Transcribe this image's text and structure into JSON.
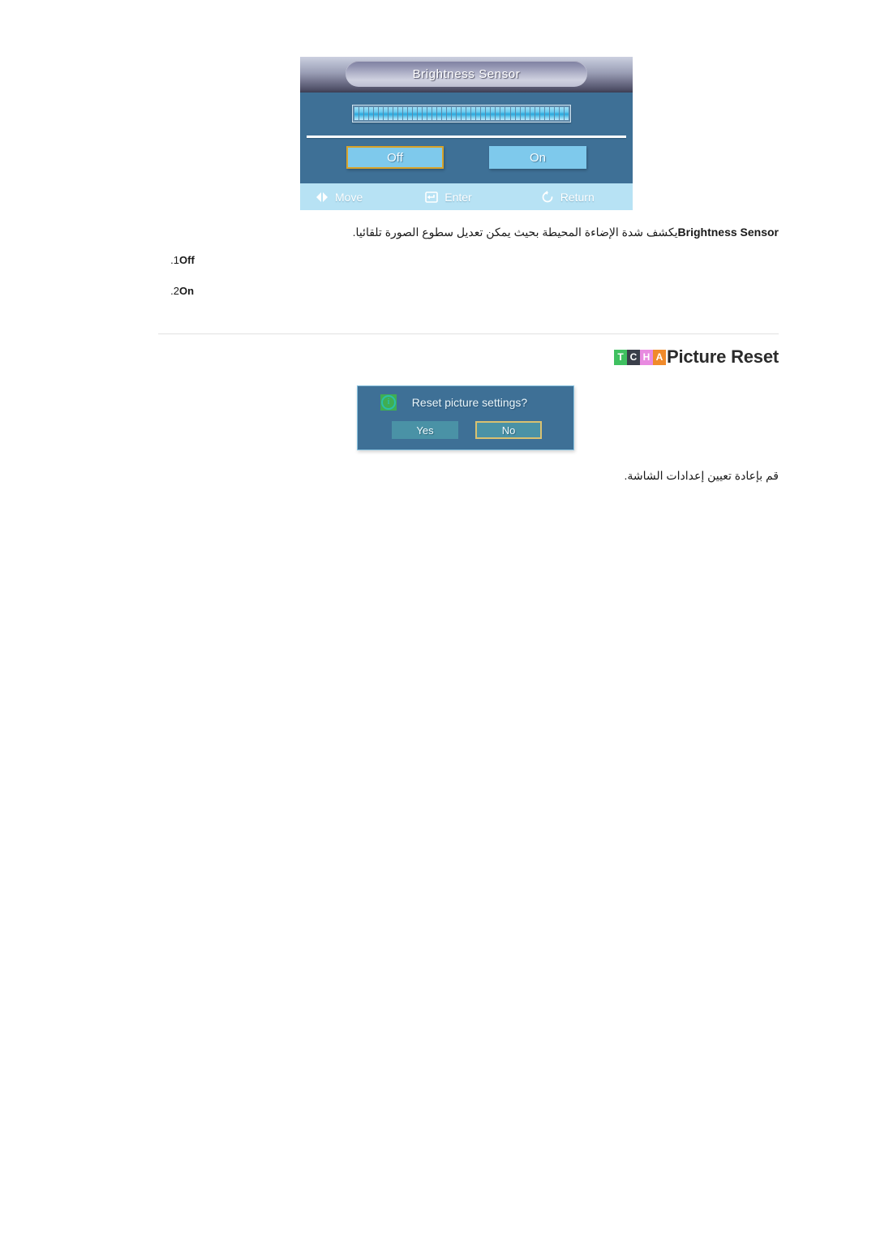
{
  "osd_brightness": {
    "title": "Brightness Sensor",
    "slider_segments": 44,
    "options": [
      {
        "label": "Off",
        "selected": true
      },
      {
        "label": "On",
        "selected": false
      }
    ],
    "footer": [
      {
        "icon": "move-arrows-icon",
        "label": "Move"
      },
      {
        "icon": "enter-key-icon",
        "label": "Enter"
      },
      {
        "icon": "return-arrow-icon",
        "label": "Return"
      }
    ]
  },
  "brightness_section": {
    "description_en": "Brightness Sensor",
    "description_ar": "يكشف شدة الإضاءة المحيطة بحيث يمكن تعديل سطوع الصورة تلقائيا.",
    "items": [
      {
        "num": "1.",
        "label": "Off"
      },
      {
        "num": "2.",
        "label": "On"
      }
    ]
  },
  "picture_reset_section": {
    "badges": [
      {
        "letter": "T",
        "color": "#3fc060"
      },
      {
        "letter": "C",
        "color": "#3a3f4a"
      },
      {
        "letter": "H",
        "color": "#e88ae0"
      },
      {
        "letter": "A",
        "color": "#f08a2a"
      }
    ],
    "title": "Picture Reset",
    "description_ar": "قم بإعادة تعيين إعدادات الشاشة."
  },
  "osd_reset": {
    "icon": "info-icon",
    "question": "Reset picture settings?",
    "buttons": [
      {
        "label": "Yes",
        "selected": false
      },
      {
        "label": "No",
        "selected": true
      }
    ]
  }
}
